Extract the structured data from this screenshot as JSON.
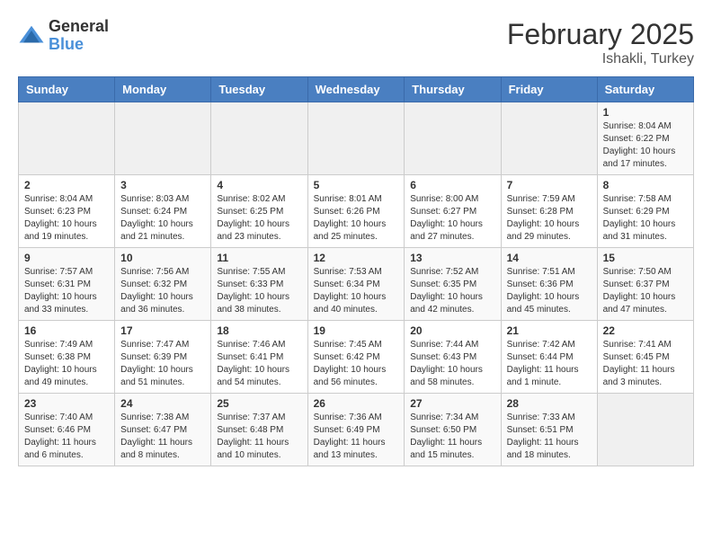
{
  "header": {
    "logo": {
      "general": "General",
      "blue": "Blue"
    },
    "title": "February 2025",
    "location": "Ishakli, Turkey"
  },
  "days_of_week": [
    "Sunday",
    "Monday",
    "Tuesday",
    "Wednesday",
    "Thursday",
    "Friday",
    "Saturday"
  ],
  "weeks": [
    [
      {
        "day": "",
        "info": ""
      },
      {
        "day": "",
        "info": ""
      },
      {
        "day": "",
        "info": ""
      },
      {
        "day": "",
        "info": ""
      },
      {
        "day": "",
        "info": ""
      },
      {
        "day": "",
        "info": ""
      },
      {
        "day": "1",
        "info": "Sunrise: 8:04 AM\nSunset: 6:22 PM\nDaylight: 10 hours\nand 17 minutes."
      }
    ],
    [
      {
        "day": "2",
        "info": "Sunrise: 8:04 AM\nSunset: 6:23 PM\nDaylight: 10 hours\nand 19 minutes."
      },
      {
        "day": "3",
        "info": "Sunrise: 8:03 AM\nSunset: 6:24 PM\nDaylight: 10 hours\nand 21 minutes."
      },
      {
        "day": "4",
        "info": "Sunrise: 8:02 AM\nSunset: 6:25 PM\nDaylight: 10 hours\nand 23 minutes."
      },
      {
        "day": "5",
        "info": "Sunrise: 8:01 AM\nSunset: 6:26 PM\nDaylight: 10 hours\nand 25 minutes."
      },
      {
        "day": "6",
        "info": "Sunrise: 8:00 AM\nSunset: 6:27 PM\nDaylight: 10 hours\nand 27 minutes."
      },
      {
        "day": "7",
        "info": "Sunrise: 7:59 AM\nSunset: 6:28 PM\nDaylight: 10 hours\nand 29 minutes."
      },
      {
        "day": "8",
        "info": "Sunrise: 7:58 AM\nSunset: 6:29 PM\nDaylight: 10 hours\nand 31 minutes."
      }
    ],
    [
      {
        "day": "9",
        "info": "Sunrise: 7:57 AM\nSunset: 6:31 PM\nDaylight: 10 hours\nand 33 minutes."
      },
      {
        "day": "10",
        "info": "Sunrise: 7:56 AM\nSunset: 6:32 PM\nDaylight: 10 hours\nand 36 minutes."
      },
      {
        "day": "11",
        "info": "Sunrise: 7:55 AM\nSunset: 6:33 PM\nDaylight: 10 hours\nand 38 minutes."
      },
      {
        "day": "12",
        "info": "Sunrise: 7:53 AM\nSunset: 6:34 PM\nDaylight: 10 hours\nand 40 minutes."
      },
      {
        "day": "13",
        "info": "Sunrise: 7:52 AM\nSunset: 6:35 PM\nDaylight: 10 hours\nand 42 minutes."
      },
      {
        "day": "14",
        "info": "Sunrise: 7:51 AM\nSunset: 6:36 PM\nDaylight: 10 hours\nand 45 minutes."
      },
      {
        "day": "15",
        "info": "Sunrise: 7:50 AM\nSunset: 6:37 PM\nDaylight: 10 hours\nand 47 minutes."
      }
    ],
    [
      {
        "day": "16",
        "info": "Sunrise: 7:49 AM\nSunset: 6:38 PM\nDaylight: 10 hours\nand 49 minutes."
      },
      {
        "day": "17",
        "info": "Sunrise: 7:47 AM\nSunset: 6:39 PM\nDaylight: 10 hours\nand 51 minutes."
      },
      {
        "day": "18",
        "info": "Sunrise: 7:46 AM\nSunset: 6:41 PM\nDaylight: 10 hours\nand 54 minutes."
      },
      {
        "day": "19",
        "info": "Sunrise: 7:45 AM\nSunset: 6:42 PM\nDaylight: 10 hours\nand 56 minutes."
      },
      {
        "day": "20",
        "info": "Sunrise: 7:44 AM\nSunset: 6:43 PM\nDaylight: 10 hours\nand 58 minutes."
      },
      {
        "day": "21",
        "info": "Sunrise: 7:42 AM\nSunset: 6:44 PM\nDaylight: 11 hours\nand 1 minute."
      },
      {
        "day": "22",
        "info": "Sunrise: 7:41 AM\nSunset: 6:45 PM\nDaylight: 11 hours\nand 3 minutes."
      }
    ],
    [
      {
        "day": "23",
        "info": "Sunrise: 7:40 AM\nSunset: 6:46 PM\nDaylight: 11 hours\nand 6 minutes."
      },
      {
        "day": "24",
        "info": "Sunrise: 7:38 AM\nSunset: 6:47 PM\nDaylight: 11 hours\nand 8 minutes."
      },
      {
        "day": "25",
        "info": "Sunrise: 7:37 AM\nSunset: 6:48 PM\nDaylight: 11 hours\nand 10 minutes."
      },
      {
        "day": "26",
        "info": "Sunrise: 7:36 AM\nSunset: 6:49 PM\nDaylight: 11 hours\nand 13 minutes."
      },
      {
        "day": "27",
        "info": "Sunrise: 7:34 AM\nSunset: 6:50 PM\nDaylight: 11 hours\nand 15 minutes."
      },
      {
        "day": "28",
        "info": "Sunrise: 7:33 AM\nSunset: 6:51 PM\nDaylight: 11 hours\nand 18 minutes."
      },
      {
        "day": "",
        "info": ""
      }
    ]
  ]
}
